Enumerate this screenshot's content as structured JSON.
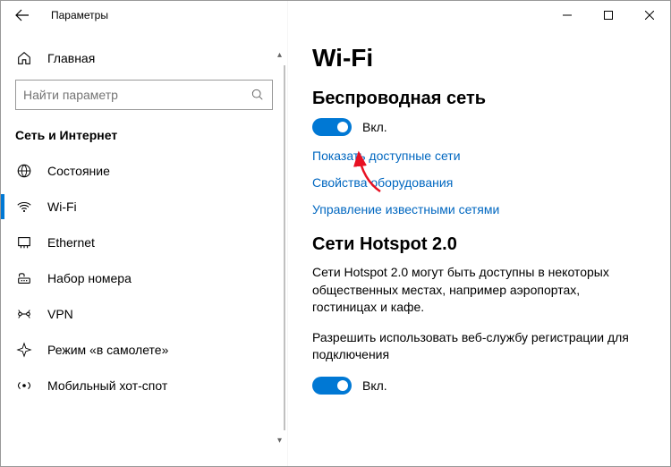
{
  "titlebar": {
    "title": "Параметры"
  },
  "sidebar": {
    "home_label": "Главная",
    "search_placeholder": "Найти параметр",
    "category": "Сеть и Интернет",
    "items": [
      {
        "label": "Состояние"
      },
      {
        "label": "Wi-Fi"
      },
      {
        "label": "Ethernet"
      },
      {
        "label": "Набор номера"
      },
      {
        "label": "VPN"
      },
      {
        "label": "Режим «в самолете»"
      },
      {
        "label": "Мобильный хот-спот"
      }
    ]
  },
  "main": {
    "title": "Wi-Fi",
    "wireless_heading": "Беспроводная сеть",
    "toggle1_label": "Вкл.",
    "link_show": "Показать доступные сети",
    "link_hw": "Свойства оборудования",
    "link_known": "Управление известными сетями",
    "hotspot_heading": "Сети Hotspot 2.0",
    "hotspot_desc": "Сети Hotspot 2.0 могут быть доступны в некоторых общественных местах, например аэропортах, гостиницах и кафе.",
    "hotspot_allow": "Разрешить использовать веб-службу регистрации для подключения",
    "toggle2_label": "Вкл."
  }
}
